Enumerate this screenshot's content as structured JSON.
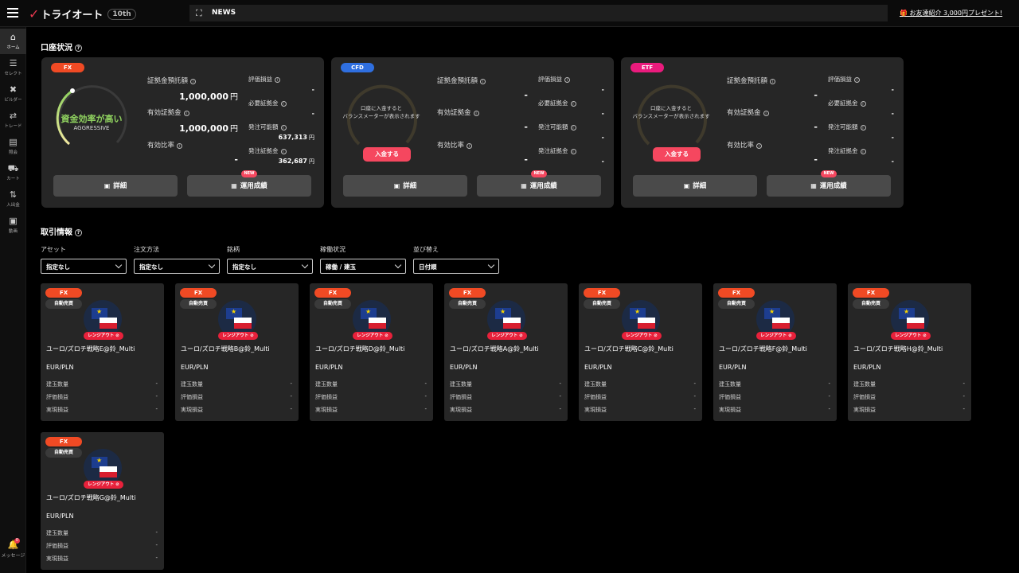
{
  "header": {
    "logo_text": "トライオート",
    "anniversary": "10th",
    "news_label": "NEWS",
    "referral": "お友達紹介 3,000円プレゼント!"
  },
  "sidebar": {
    "items": [
      {
        "label": "ホーム",
        "icon": "home-icon",
        "glyph": "⌂"
      },
      {
        "label": "セレクト",
        "icon": "select-icon",
        "glyph": "☰"
      },
      {
        "label": "ビルダー",
        "icon": "builder-icon",
        "glyph": "✖"
      },
      {
        "label": "トレード",
        "icon": "trade-icon",
        "glyph": "⇄"
      },
      {
        "label": "照会",
        "icon": "inquiry-icon",
        "glyph": "▤"
      },
      {
        "label": "カート",
        "icon": "cart-icon",
        "glyph": "⛟"
      },
      {
        "label": "入出金",
        "icon": "transfer-icon",
        "glyph": "⇅"
      },
      {
        "label": "動画",
        "icon": "video-icon",
        "glyph": "▣"
      }
    ],
    "message_label": "メッセージ",
    "message_badge": "0"
  },
  "account": {
    "title": "口座状況",
    "cards": [
      {
        "tag": "FX",
        "gauge_title": "資金効率が高い",
        "gauge_sub": "AGGRESSIVE",
        "deposit_label": "証拠金預託額",
        "deposit_value": "1,000,000",
        "effective_label": "有効証拠金",
        "effective_value": "1,000,000",
        "ratio_label": "有効比率",
        "ratio_value": "-",
        "unit": "円",
        "pl_label": "評価損益",
        "pl_value": "-",
        "required_label": "必要証拠金",
        "required_value": "-",
        "orderable_label": "発注可能額",
        "orderable_value": "637,313",
        "order_margin_label": "発注証拠金",
        "order_margin_value": "362,687",
        "detail_btn": "詳細",
        "perf_btn": "運用成績",
        "new_badge": "NEW"
      },
      {
        "tag": "CFD",
        "gauge_msg": "口座に入金すると\nバランスメーターが表示されます",
        "deposit_btn": "入金する",
        "deposit_label": "証拠金預託額",
        "deposit_value": "-",
        "effective_label": "有効証拠金",
        "effective_value": "-",
        "ratio_label": "有効比率",
        "ratio_value": "-",
        "pl_label": "評価損益",
        "pl_value": "-",
        "required_label": "必要証拠金",
        "required_value": "-",
        "orderable_label": "発注可能額",
        "orderable_value": "-",
        "order_margin_label": "発注証拠金",
        "order_margin_value": "-",
        "detail_btn": "詳細",
        "perf_btn": "運用成績",
        "new_badge": "NEW"
      },
      {
        "tag": "ETF",
        "gauge_msg": "口座に入金すると\nバランスメーターが表示されます",
        "deposit_btn": "入金する",
        "deposit_label": "証拠金預託額",
        "deposit_value": "-",
        "effective_label": "有効証拠金",
        "effective_value": "-",
        "ratio_label": "有効比率",
        "ratio_value": "-",
        "pl_label": "評価損益",
        "pl_value": "-",
        "required_label": "必要証拠金",
        "required_value": "-",
        "orderable_label": "発注可能額",
        "orderable_value": "-",
        "order_margin_label": "発注証拠金",
        "order_margin_value": "-",
        "detail_btn": "詳細",
        "perf_btn": "運用成績",
        "new_badge": "NEW"
      }
    ]
  },
  "trades": {
    "title": "取引情報",
    "filters": [
      {
        "label": "アセット",
        "value": "指定なし"
      },
      {
        "label": "注文方法",
        "value": "指定なし"
      },
      {
        "label": "銘柄",
        "value": "指定なし"
      },
      {
        "label": "稼働状況",
        "value": "稼働 / 建玉"
      },
      {
        "label": "並び替え",
        "value": "日付順"
      }
    ],
    "card_common": {
      "tag": "FX",
      "type": "自動売買",
      "range": "レンジアウト",
      "pair": "EUR/PLN",
      "k1": "建玉数量",
      "k2": "評価損益",
      "k3": "実現損益",
      "v": "-"
    },
    "strategies": [
      "ユーロ/ズロチ戦略E@鈴_Multi",
      "ユーロ/ズロチ戦略B@鈴_Multi",
      "ユーロ/ズロチ戦略D@鈴_Multi",
      "ユーロ/ズロチ戦略A@鈴_Multi",
      "ユーロ/ズロチ戦略C@鈴_Multi",
      "ユーロ/ズロチ戦略F@鈴_Multi",
      "ユーロ/ズロチ戦略H@鈴_Multi",
      "ユーロ/ズロチ戦略G@鈴_Multi"
    ]
  }
}
